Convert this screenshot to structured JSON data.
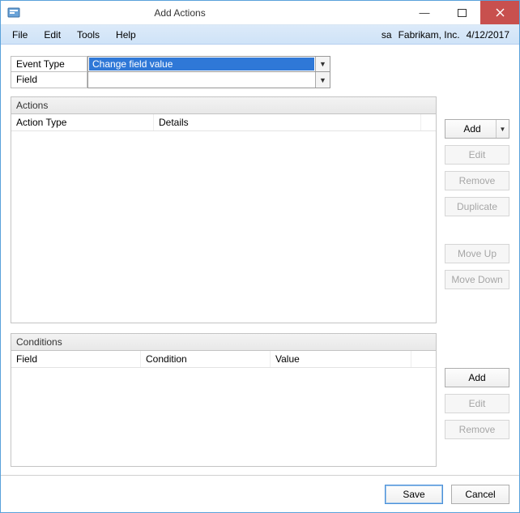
{
  "titlebar": {
    "title": "Add Actions"
  },
  "menu": {
    "items": [
      "File",
      "Edit",
      "Tools",
      "Help"
    ],
    "user": "sa",
    "company": "Fabrikam, Inc.",
    "date": "4/12/2017"
  },
  "form": {
    "eventTypeLabel": "Event Type",
    "fieldLabel": "Field",
    "eventTypeValue": "Change field value",
    "fieldValue": ""
  },
  "panels": {
    "actions": {
      "title": "Actions",
      "cols": {
        "actionType": "Action Type",
        "details": "Details"
      }
    },
    "conditions": {
      "title": "Conditions",
      "cols": {
        "field": "Field",
        "condition": "Condition",
        "value": "Value"
      }
    }
  },
  "buttons": {
    "actions": {
      "add": "Add",
      "edit": "Edit",
      "remove": "Remove",
      "duplicate": "Duplicate",
      "moveUp": "Move Up",
      "moveDown": "Move Down"
    },
    "conditions": {
      "add": "Add",
      "edit": "Edit",
      "remove": "Remove"
    }
  },
  "footer": {
    "save": "Save",
    "cancel": "Cancel"
  }
}
